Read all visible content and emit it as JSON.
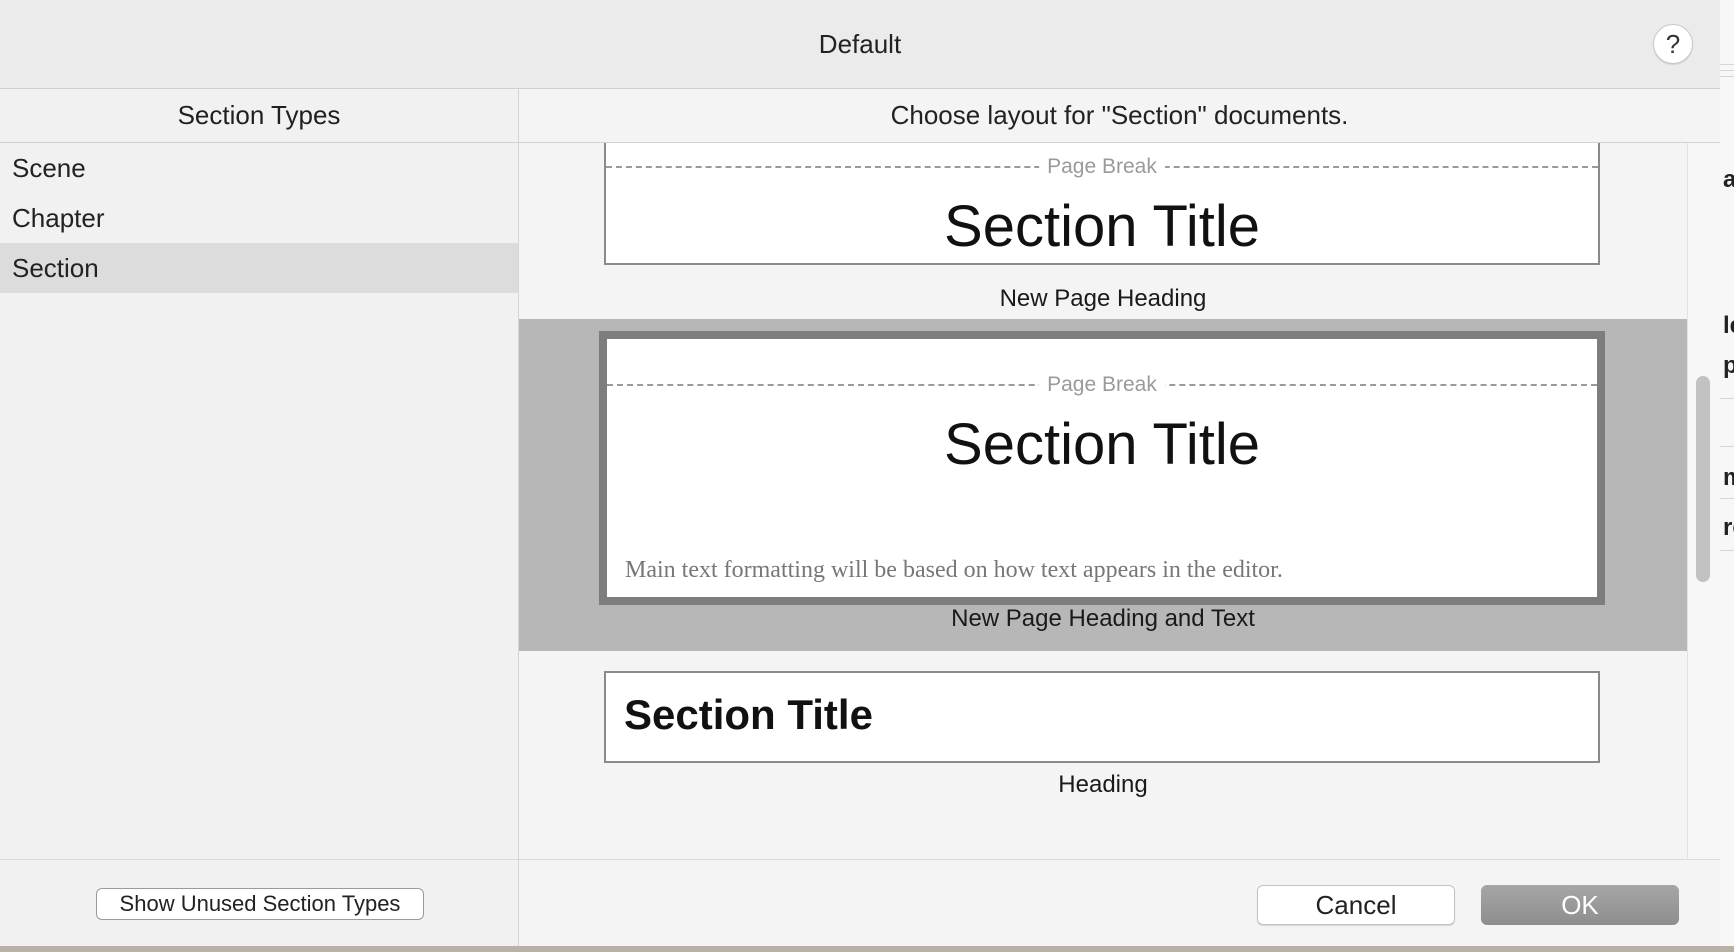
{
  "window": {
    "title": "Default",
    "help_glyph": "?"
  },
  "left_panel": {
    "header": "Section Types",
    "items": [
      {
        "label": "Scene",
        "selected": false
      },
      {
        "label": "Chapter",
        "selected": false
      },
      {
        "label": "Section",
        "selected": true
      }
    ],
    "show_unused_label": "Show Unused Section Types"
  },
  "right_panel": {
    "header": "Choose layout for \"Section\" documents.",
    "layouts": [
      {
        "page_break": "Page Break",
        "title": "Section Title",
        "label": "New Page Heading",
        "selected": false
      },
      {
        "page_break": "Page Break",
        "title": "Section Title",
        "body": "Main text formatting will be based on how text appears in the editor.",
        "label": "New Page Heading and Text",
        "selected": true
      },
      {
        "title": "Section Title",
        "label": "Heading",
        "selected": false
      }
    ]
  },
  "buttons": {
    "cancel": "Cancel",
    "ok": "OK"
  },
  "background_fragments": [
    "al",
    "le",
    "p",
    "m",
    "re"
  ],
  "colors": {
    "selection_band": "#b7b7b7",
    "list_selection": "#dcdcdc",
    "ok_button": "#9a9a9a"
  }
}
